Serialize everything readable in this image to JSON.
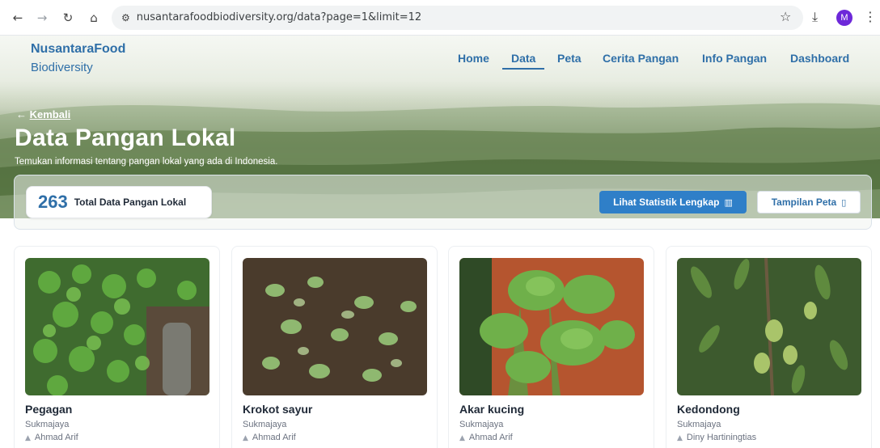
{
  "browser": {
    "url": "nusantarafoodbiodiversity.org/data?page=1&limit=12",
    "profile_initial": "M",
    "icons": [
      "back-arrow-icon",
      "forward-arrow-icon",
      "reload-icon",
      "home-icon",
      "site-settings-icon",
      "star-icon",
      "download-icon",
      "more-vert-icon"
    ]
  },
  "brand": {
    "line1": "NusantaraFood",
    "line2": "Biodiversity"
  },
  "nav": {
    "items": [
      {
        "label": "Home"
      },
      {
        "label": "Data"
      },
      {
        "label": "Peta"
      },
      {
        "label": "Cerita Pangan"
      },
      {
        "label": "Info Pangan"
      },
      {
        "label": "Dashboard"
      }
    ],
    "active": "Data"
  },
  "hero": {
    "back_label": "Kembali",
    "title": "Data Pangan Lokal",
    "subtitle": "Temukan informasi tentang pangan lokal yang ada di Indonesia."
  },
  "stats": {
    "total": "263",
    "total_label": "Total Data Pangan Lokal",
    "stats_button": "Lihat Statistik Lengkap",
    "map_button": "Tampilan Peta"
  },
  "cards": [
    {
      "name": "Pegagan",
      "location": "Sukmajaya",
      "author": "Ahmad Arif"
    },
    {
      "name": "Krokot sayur",
      "location": "Sukmajaya",
      "author": "Ahmad Arif"
    },
    {
      "name": "Akar kucing",
      "location": "Sukmajaya",
      "author": "Ahmad Arif"
    },
    {
      "name": "Kedondong",
      "location": "Sukmajaya",
      "author": "Diny Hartiningtias"
    }
  ],
  "colors": {
    "brand": "#2f6fa8",
    "primary_button": "#2f7fc8",
    "text": "#1f2937",
    "muted": "#6b7280"
  }
}
